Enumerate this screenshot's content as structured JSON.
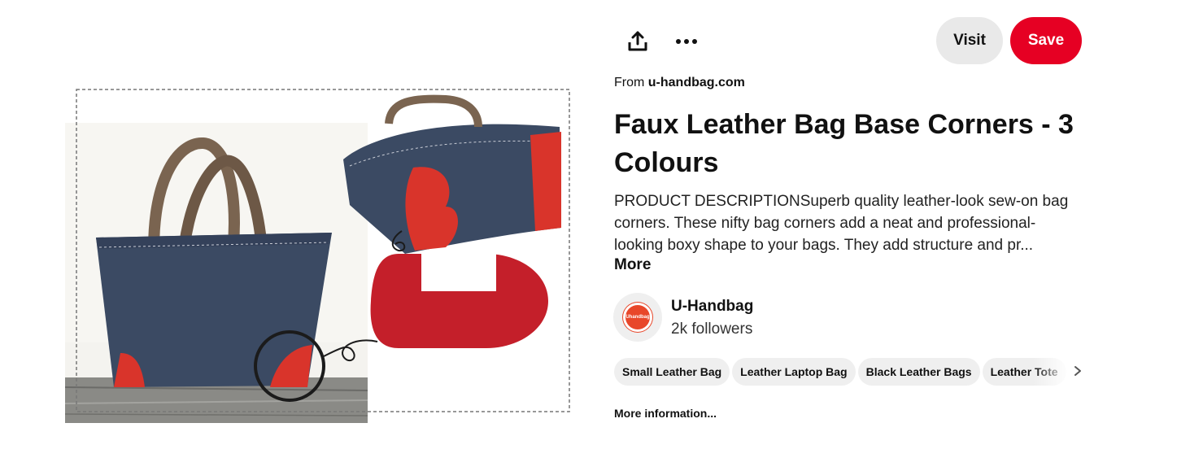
{
  "toolbar": {
    "share_icon": "share-upload-icon",
    "more_icon": "ellipsis-icon",
    "visit_label": "Visit",
    "save_label": "Save",
    "save_color": "#e60023",
    "visit_color": "#e9e9e9"
  },
  "pin": {
    "source_prefix": "From",
    "source_domain": "u-handbag.com",
    "title": "Faux Leather Bag Base Corners - 3 Colours",
    "description": "PRODUCT DESCRIPTIONSuperb quality leather-look sew-on bag corners. These nifty bag corners add a neat and professional-looking boxy shape to your bags. They add structure and pr...",
    "more_label": "More"
  },
  "creator": {
    "avatar_text": "Uhandbag",
    "name": "U-Handbag",
    "followers": "2k followers"
  },
  "tags": [
    "Small Leather Bag",
    "Leather Laptop Bag",
    "Black Leather Bags",
    "Leather Tote"
  ],
  "more_information_label": "More information...",
  "colors": {
    "accent_red": "#e60023",
    "leather_red": "#d9342b",
    "denim_blue": "#3b4a63",
    "handle_brown": "#7a6450"
  }
}
